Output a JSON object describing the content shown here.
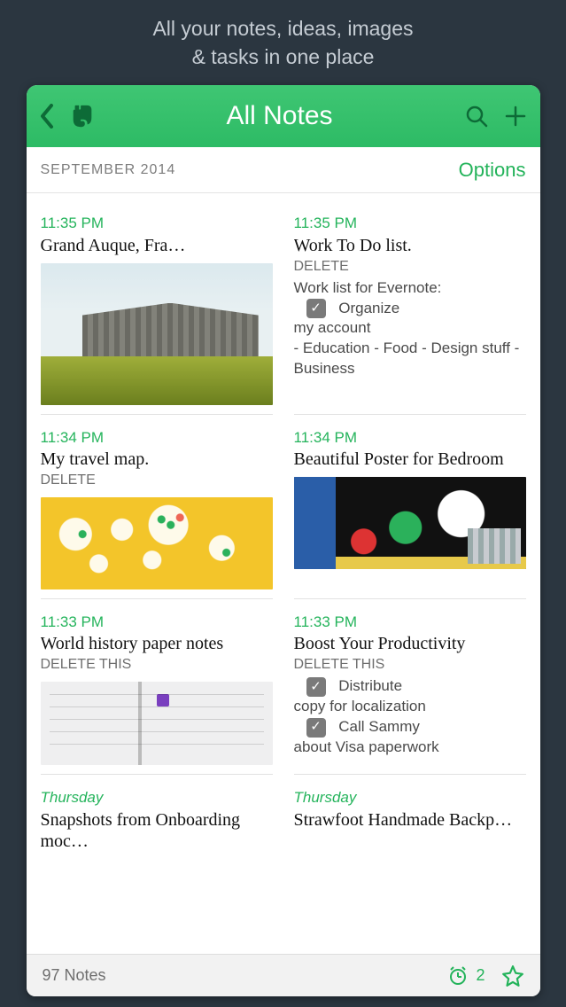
{
  "tagline_line1": "All your notes, ideas, images",
  "tagline_line2": "& tasks in one place",
  "header": {
    "title": "All Notes"
  },
  "subheader": {
    "month": "SEPTEMBER 2014",
    "options": "Options"
  },
  "notes": [
    {
      "time": "11:35 PM",
      "title": "Grand Auque, Fra…",
      "sub": "",
      "body": "",
      "thumb": "barn"
    },
    {
      "time": "11:35 PM",
      "title": "Work To Do list.",
      "sub": "DELETE",
      "body_pre": "Work list for Evernote:",
      "check1": "Organize",
      "body_post": "my account\n- Education - Food - Design stuff - Business"
    },
    {
      "time": "11:34 PM",
      "title": "My travel map.",
      "sub": "DELETE",
      "thumb": "worldmap"
    },
    {
      "time": "11:34 PM",
      "title": "Beautiful  Poster for Bedroom",
      "thumb": "poster"
    },
    {
      "time": "11:33 PM",
      "title": "World history paper notes",
      "sub": "DELETE THIS",
      "thumb": "notebook"
    },
    {
      "time": "11:33 PM",
      "title": "Boost Your Productivity",
      "sub": "DELETE THIS",
      "check1": "Distribute",
      "body_mid": "copy for localization",
      "check2": "Call Sammy",
      "body_post": "about Visa paperwork"
    },
    {
      "time": "Thursday",
      "time_italic": true,
      "title": "Snapshots from Onboarding moc…"
    },
    {
      "time": "Thursday",
      "time_italic": true,
      "title": "Strawfoot Handmade Backp…"
    }
  ],
  "footer": {
    "count": "97 Notes",
    "reminders": "2"
  }
}
